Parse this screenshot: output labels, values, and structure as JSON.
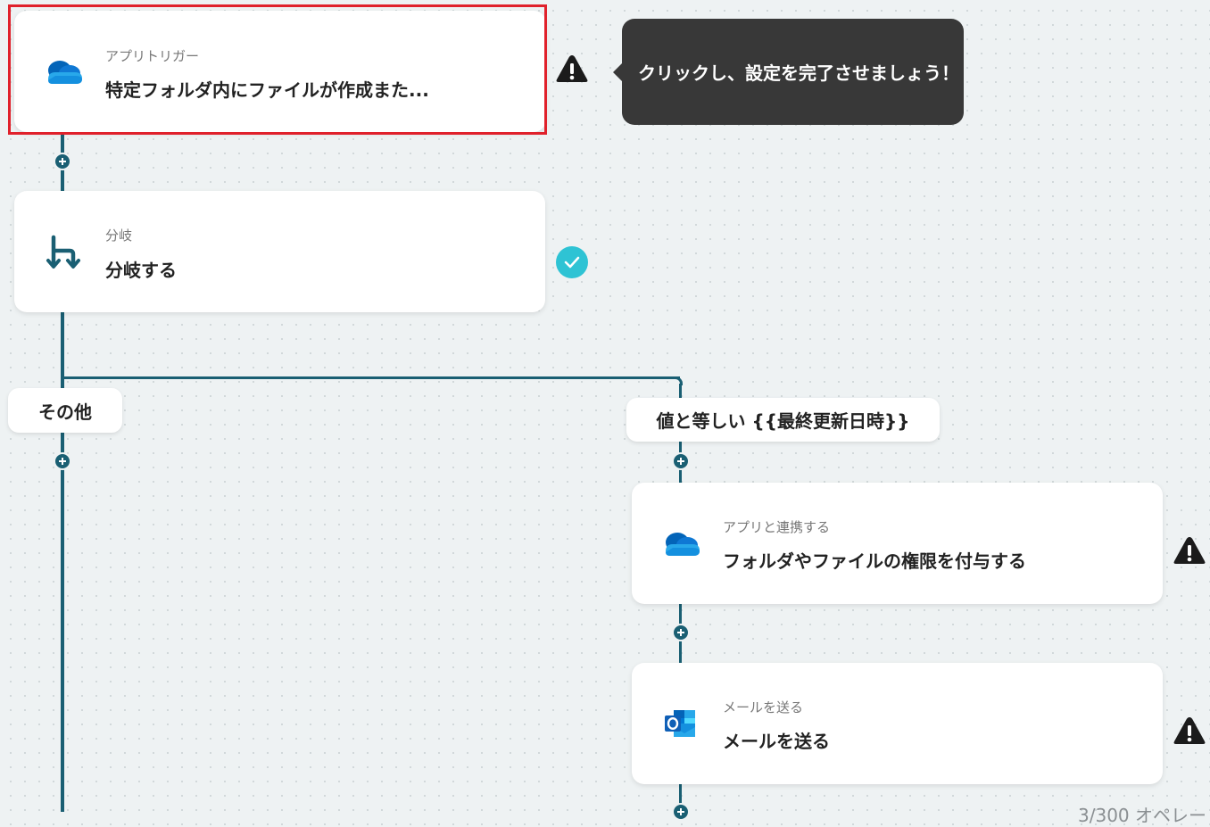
{
  "trigger_card": {
    "subtitle": "アプリトリガー",
    "title": "特定フォルダ内にファイルが作成また...",
    "icon": "onedrive-cloud-icon",
    "status": "warning"
  },
  "tooltip": {
    "text": "クリックし、設定を完了させましょう！"
  },
  "branch_card": {
    "subtitle": "分岐",
    "title": "分岐する",
    "icon": "branch-icon",
    "status": "complete"
  },
  "branches": {
    "other_label": "その他",
    "condition_label": "値と等しい {{最終更新日時}}"
  },
  "permission_card": {
    "subtitle": "アプリと連携する",
    "title": "フォルダやファイルの権限を付与する",
    "icon": "onedrive-cloud-icon",
    "status": "warning"
  },
  "mail_card": {
    "subtitle": "メールを送る",
    "title": "メールを送る",
    "icon": "outlook-icon",
    "status": "warning"
  },
  "footer": {
    "operations": "3/300 オペレー"
  },
  "colors": {
    "connector": "#1a5f73",
    "highlight": "#e0212b",
    "check": "#2ec3d4",
    "tooltip_bg": "#383838"
  }
}
